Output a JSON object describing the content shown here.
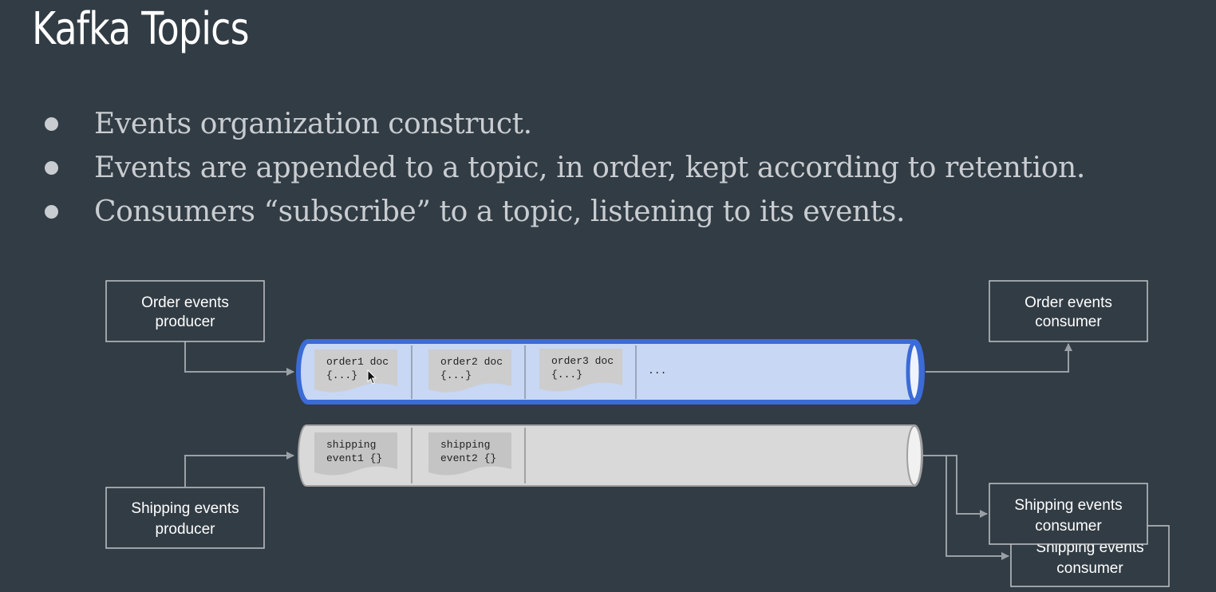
{
  "title": "Kafka Topics",
  "bullets": [
    "Events organization construct.",
    "Events are appended to a topic, in order, kept according to retention.",
    "Consumers “subscribe” to a topic, listening to its events."
  ],
  "boxes": {
    "order_producer": [
      "Order events",
      "producer"
    ],
    "order_consumer": [
      "Order events",
      "consumer"
    ],
    "shipping_producer": [
      "Shipping events",
      "producer"
    ],
    "shipping_consumer_1": [
      "Shipping events",
      "consumer"
    ],
    "shipping_consumer_2": [
      "Shipping events",
      "consumer"
    ]
  },
  "order_topic": {
    "docs": [
      [
        "order1 doc",
        "{...}"
      ],
      [
        "order2 doc",
        "{...}"
      ],
      [
        "order3 doc",
        "{...}"
      ]
    ],
    "ellipsis": "...",
    "fill": "#c7d7f4",
    "border": "#3b6bd6"
  },
  "shipping_topic": {
    "docs": [
      [
        "shipping",
        "event1 {}"
      ],
      [
        "shipping",
        "event2 {}"
      ]
    ],
    "fill": "#d9d9d9",
    "border": "#a0a0a0"
  },
  "colors": {
    "background": "#323c44",
    "arrow": "#9aa0a6",
    "box_border": "#bfc3c7"
  },
  "icons": {
    "cursor": "mouse-pointer-icon"
  }
}
